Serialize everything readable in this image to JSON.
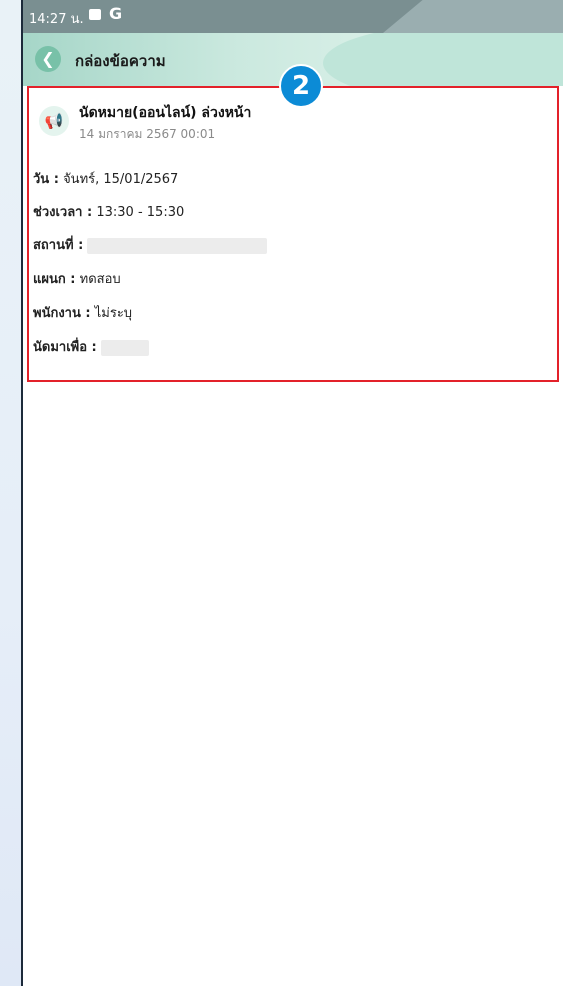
{
  "status_bar": {
    "time": "14:27 น.",
    "icons": [
      "message-icon",
      "google-icon"
    ]
  },
  "header": {
    "back_icon": "chevron-left-icon",
    "title": "กล่องข้อความ"
  },
  "badge": {
    "number": "2"
  },
  "message": {
    "icon": "megaphone-icon",
    "title": "นัดหมาย(ออนไลน์) ล่วงหน้า",
    "date": "14 มกราคม 2567 00:01",
    "fields": [
      {
        "label": "วัน :",
        "value": "จันทร์, 15/01/2567"
      },
      {
        "label": "ช่วงเวลา :",
        "value": "13:30 - 15:30"
      },
      {
        "label": "สถานที่ :",
        "value": ""
      },
      {
        "label": "แผนก :",
        "value": "ทดสอบ"
      },
      {
        "label": "พนักงาน :",
        "value": "ไม่ระบุ"
      },
      {
        "label": "นัดมาเพื่อ :",
        "value": ""
      }
    ]
  },
  "colors": {
    "highlight_border": "#e3212a",
    "badge": "#0c8bd6",
    "header_accent": "#78c1a8"
  }
}
